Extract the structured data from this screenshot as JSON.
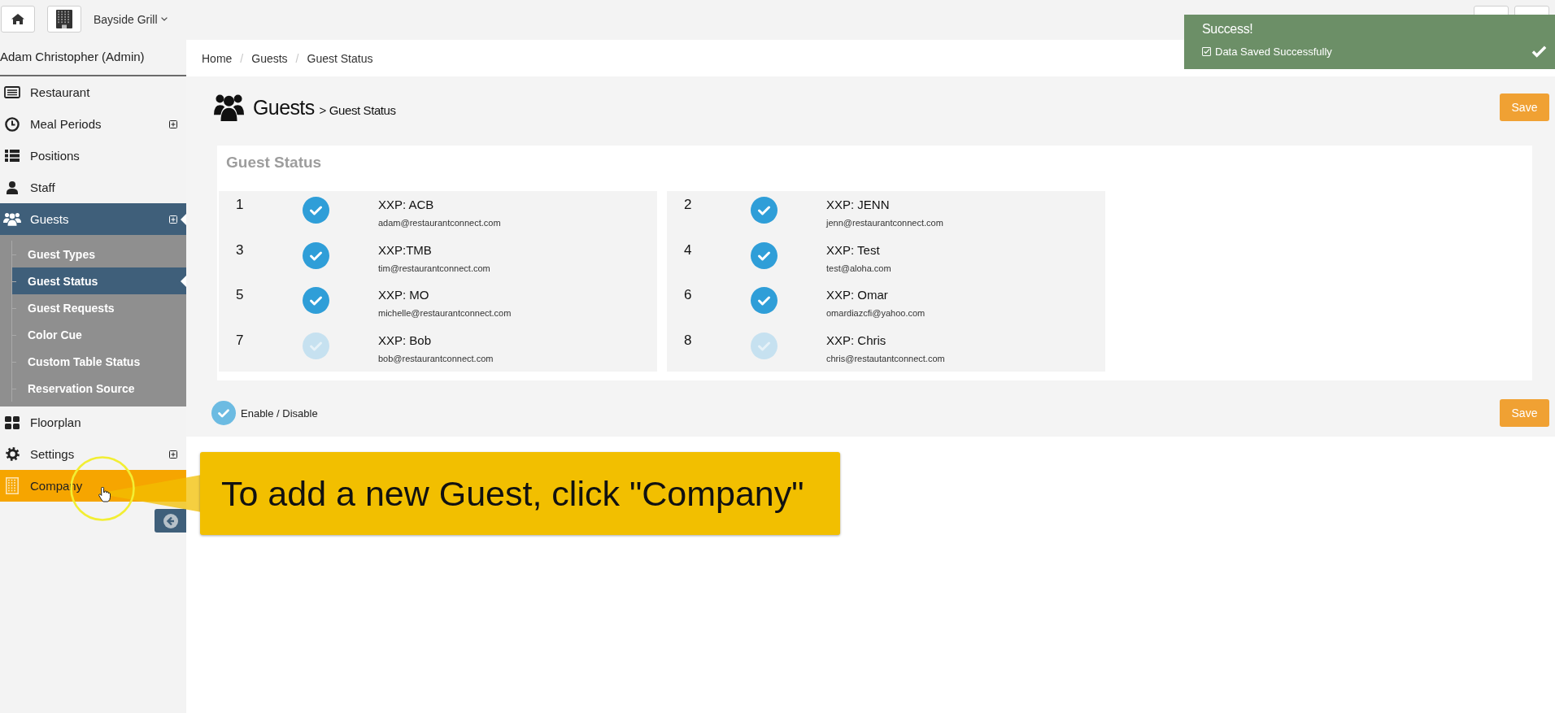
{
  "top_bar": {
    "venue": "Bayside Grill"
  },
  "toast": {
    "title": "Success!",
    "message": "Data Saved Successfully"
  },
  "sidebar": {
    "user": "Adam Christopher (Admin)",
    "items": [
      {
        "label": "Restaurant",
        "expandable": false,
        "selected": false,
        "highlighted": false
      },
      {
        "label": "Meal Periods",
        "expandable": true,
        "selected": false,
        "highlighted": false
      },
      {
        "label": "Positions",
        "expandable": false,
        "selected": false,
        "highlighted": false
      },
      {
        "label": "Staff",
        "expandable": false,
        "selected": false,
        "highlighted": false
      },
      {
        "label": "Guests",
        "expandable": true,
        "selected": true,
        "highlighted": false,
        "children": [
          {
            "label": "Guest Types",
            "selected": false
          },
          {
            "label": "Guest Status",
            "selected": true
          },
          {
            "label": "Guest Requests",
            "selected": false
          },
          {
            "label": "Color Cue",
            "selected": false
          },
          {
            "label": "Custom Table Status",
            "selected": false
          },
          {
            "label": "Reservation Source",
            "selected": false
          }
        ]
      },
      {
        "label": "Floorplan",
        "expandable": false,
        "selected": false,
        "highlighted": false
      },
      {
        "label": "Settings",
        "expandable": true,
        "selected": false,
        "highlighted": false
      },
      {
        "label": "Company",
        "expandable": false,
        "selected": false,
        "highlighted": true
      }
    ]
  },
  "breadcrumb": {
    "items": [
      {
        "label": "Home"
      },
      {
        "separator": "/",
        "label": "Guests"
      },
      {
        "separator": "/",
        "label": "Guest Status"
      }
    ]
  },
  "page": {
    "title": "Guests",
    "subtitle": "> Guest Status",
    "save": "Save"
  },
  "card": {
    "title": "Guest Status",
    "panels": [
      {
        "guests": [
          {
            "number": "1",
            "name": "XXP: ACB",
            "email": "adam@restaurantconnect.com",
            "enabled": true
          },
          {
            "number": "3",
            "name": "XXP:TMB",
            "email": "tim@restaurantconnect.com",
            "enabled": true
          },
          {
            "number": "5",
            "name": "XXP: MO",
            "email": "michelle@restaurantconnect.com",
            "enabled": true
          },
          {
            "number": "7",
            "name": "XXP: Bob",
            "email": "bob@restaurantconnect.com",
            "enabled": false
          }
        ]
      },
      {
        "guests": [
          {
            "number": "2",
            "name": "XXP: JENN",
            "email": "jenn@restaurantconnect.com",
            "enabled": true
          },
          {
            "number": "4",
            "name": "XXP: Test",
            "email": "test@aloha.com",
            "enabled": true
          },
          {
            "number": "6",
            "name": "XXP: Omar",
            "email": "omardiazcfi@yahoo.com",
            "enabled": true
          },
          {
            "number": "8",
            "name": "XXP: Chris",
            "email": "chris@restautantconnect.com",
            "enabled": false
          }
        ]
      }
    ]
  },
  "legend": {
    "label": "Enable / Disable"
  },
  "footer": {
    "save": "Save"
  },
  "callout": {
    "text": "To add a new Guest, click \"Company\""
  }
}
